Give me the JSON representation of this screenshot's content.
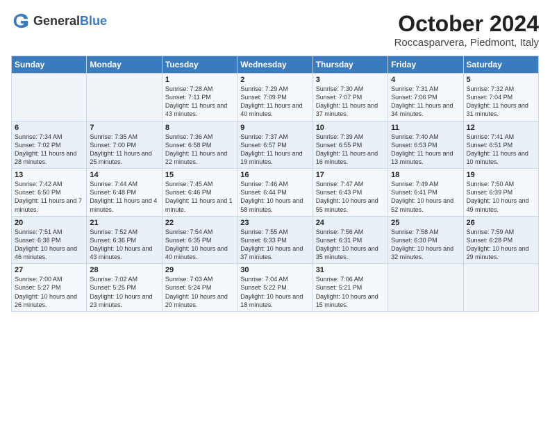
{
  "header": {
    "logo_general": "General",
    "logo_blue": "Blue",
    "month": "October 2024",
    "location": "Roccasparvera, Piedmont, Italy"
  },
  "days_of_week": [
    "Sunday",
    "Monday",
    "Tuesday",
    "Wednesday",
    "Thursday",
    "Friday",
    "Saturday"
  ],
  "weeks": [
    [
      {
        "day": "",
        "info": ""
      },
      {
        "day": "",
        "info": ""
      },
      {
        "day": "1",
        "info": "Sunrise: 7:28 AM\nSunset: 7:11 PM\nDaylight: 11 hours and 43 minutes."
      },
      {
        "day": "2",
        "info": "Sunrise: 7:29 AM\nSunset: 7:09 PM\nDaylight: 11 hours and 40 minutes."
      },
      {
        "day": "3",
        "info": "Sunrise: 7:30 AM\nSunset: 7:07 PM\nDaylight: 11 hours and 37 minutes."
      },
      {
        "day": "4",
        "info": "Sunrise: 7:31 AM\nSunset: 7:06 PM\nDaylight: 11 hours and 34 minutes."
      },
      {
        "day": "5",
        "info": "Sunrise: 7:32 AM\nSunset: 7:04 PM\nDaylight: 11 hours and 31 minutes."
      }
    ],
    [
      {
        "day": "6",
        "info": "Sunrise: 7:34 AM\nSunset: 7:02 PM\nDaylight: 11 hours and 28 minutes."
      },
      {
        "day": "7",
        "info": "Sunrise: 7:35 AM\nSunset: 7:00 PM\nDaylight: 11 hours and 25 minutes."
      },
      {
        "day": "8",
        "info": "Sunrise: 7:36 AM\nSunset: 6:58 PM\nDaylight: 11 hours and 22 minutes."
      },
      {
        "day": "9",
        "info": "Sunrise: 7:37 AM\nSunset: 6:57 PM\nDaylight: 11 hours and 19 minutes."
      },
      {
        "day": "10",
        "info": "Sunrise: 7:39 AM\nSunset: 6:55 PM\nDaylight: 11 hours and 16 minutes."
      },
      {
        "day": "11",
        "info": "Sunrise: 7:40 AM\nSunset: 6:53 PM\nDaylight: 11 hours and 13 minutes."
      },
      {
        "day": "12",
        "info": "Sunrise: 7:41 AM\nSunset: 6:51 PM\nDaylight: 11 hours and 10 minutes."
      }
    ],
    [
      {
        "day": "13",
        "info": "Sunrise: 7:42 AM\nSunset: 6:50 PM\nDaylight: 11 hours and 7 minutes."
      },
      {
        "day": "14",
        "info": "Sunrise: 7:44 AM\nSunset: 6:48 PM\nDaylight: 11 hours and 4 minutes."
      },
      {
        "day": "15",
        "info": "Sunrise: 7:45 AM\nSunset: 6:46 PM\nDaylight: 11 hours and 1 minute."
      },
      {
        "day": "16",
        "info": "Sunrise: 7:46 AM\nSunset: 6:44 PM\nDaylight: 10 hours and 58 minutes."
      },
      {
        "day": "17",
        "info": "Sunrise: 7:47 AM\nSunset: 6:43 PM\nDaylight: 10 hours and 55 minutes."
      },
      {
        "day": "18",
        "info": "Sunrise: 7:49 AM\nSunset: 6:41 PM\nDaylight: 10 hours and 52 minutes."
      },
      {
        "day": "19",
        "info": "Sunrise: 7:50 AM\nSunset: 6:39 PM\nDaylight: 10 hours and 49 minutes."
      }
    ],
    [
      {
        "day": "20",
        "info": "Sunrise: 7:51 AM\nSunset: 6:38 PM\nDaylight: 10 hours and 46 minutes."
      },
      {
        "day": "21",
        "info": "Sunrise: 7:52 AM\nSunset: 6:36 PM\nDaylight: 10 hours and 43 minutes."
      },
      {
        "day": "22",
        "info": "Sunrise: 7:54 AM\nSunset: 6:35 PM\nDaylight: 10 hours and 40 minutes."
      },
      {
        "day": "23",
        "info": "Sunrise: 7:55 AM\nSunset: 6:33 PM\nDaylight: 10 hours and 37 minutes."
      },
      {
        "day": "24",
        "info": "Sunrise: 7:56 AM\nSunset: 6:31 PM\nDaylight: 10 hours and 35 minutes."
      },
      {
        "day": "25",
        "info": "Sunrise: 7:58 AM\nSunset: 6:30 PM\nDaylight: 10 hours and 32 minutes."
      },
      {
        "day": "26",
        "info": "Sunrise: 7:59 AM\nSunset: 6:28 PM\nDaylight: 10 hours and 29 minutes."
      }
    ],
    [
      {
        "day": "27",
        "info": "Sunrise: 7:00 AM\nSunset: 5:27 PM\nDaylight: 10 hours and 26 minutes."
      },
      {
        "day": "28",
        "info": "Sunrise: 7:02 AM\nSunset: 5:25 PM\nDaylight: 10 hours and 23 minutes."
      },
      {
        "day": "29",
        "info": "Sunrise: 7:03 AM\nSunset: 5:24 PM\nDaylight: 10 hours and 20 minutes."
      },
      {
        "day": "30",
        "info": "Sunrise: 7:04 AM\nSunset: 5:22 PM\nDaylight: 10 hours and 18 minutes."
      },
      {
        "day": "31",
        "info": "Sunrise: 7:06 AM\nSunset: 5:21 PM\nDaylight: 10 hours and 15 minutes."
      },
      {
        "day": "",
        "info": ""
      },
      {
        "day": "",
        "info": ""
      }
    ]
  ]
}
